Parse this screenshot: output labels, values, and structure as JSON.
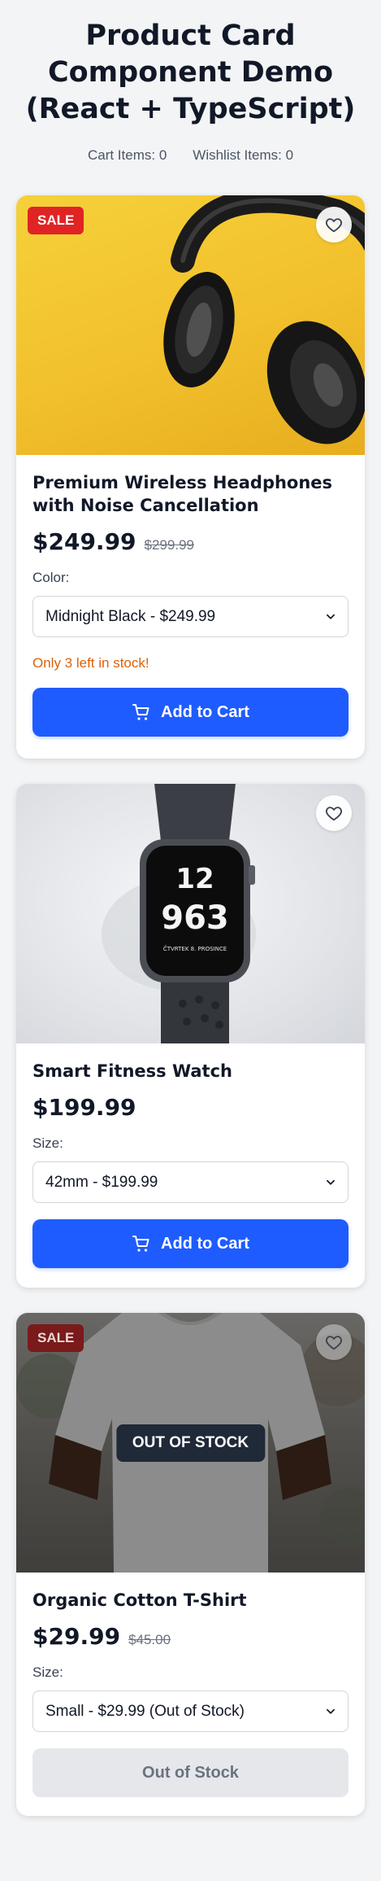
{
  "page": {
    "title": "Product Card Component Demo (React + TypeScript)",
    "cart_label": "Cart Items: 0",
    "wishlist_label": "Wishlist Items: 0"
  },
  "products": [
    {
      "name": "Premium Wireless Headphones with Noise Cancellation",
      "badge": "SALE",
      "price": "$249.99",
      "old_price": "$299.99",
      "variant_label": "Color:",
      "selected_variant": "Midnight Black - $249.99",
      "stock_note": "Only 3 left in stock!",
      "button_label": "Add to Cart"
    },
    {
      "name": "Smart Fitness Watch",
      "price": "$199.99",
      "variant_label": "Size:",
      "selected_variant": "42mm - $199.99",
      "button_label": "Add to Cart",
      "watch_face": {
        "hour_top": "12",
        "digits_row": "963",
        "date_line": "ČTVRTEK 8. PROSINCE"
      }
    },
    {
      "name": "Organic Cotton T-Shirt",
      "badge": "SALE",
      "overlay_label": "OUT OF STOCK",
      "price": "$29.99",
      "old_price": "$45.00",
      "variant_label": "Size:",
      "selected_variant": "Small - $29.99 (Out of Stock)",
      "button_label": "Out of Stock"
    }
  ],
  "icons": {
    "wishlist": "heart-icon",
    "cart": "cart-icon",
    "dropdown": "chevron-down-icon"
  },
  "colors": {
    "accent": "#1f5cff",
    "sale": "#e02424",
    "warning": "#d9620b",
    "background": "#f3f4f6"
  }
}
